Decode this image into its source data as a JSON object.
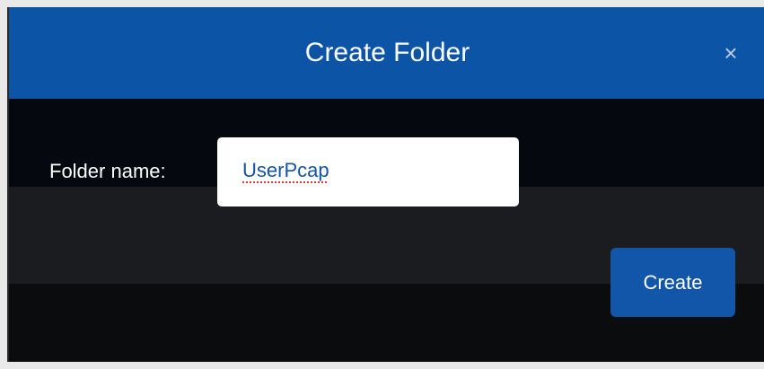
{
  "dialog": {
    "title": "Create Folder",
    "close_icon": "close-icon",
    "close_glyph": "×"
  },
  "form": {
    "label": "Folder name:",
    "value": "UserPcap"
  },
  "actions": {
    "create_label": "Create"
  },
  "colors": {
    "header": "#0c55a6",
    "button": "#1156a8",
    "body_dark": "#05080e",
    "body_mid": "#1b1c1f"
  }
}
